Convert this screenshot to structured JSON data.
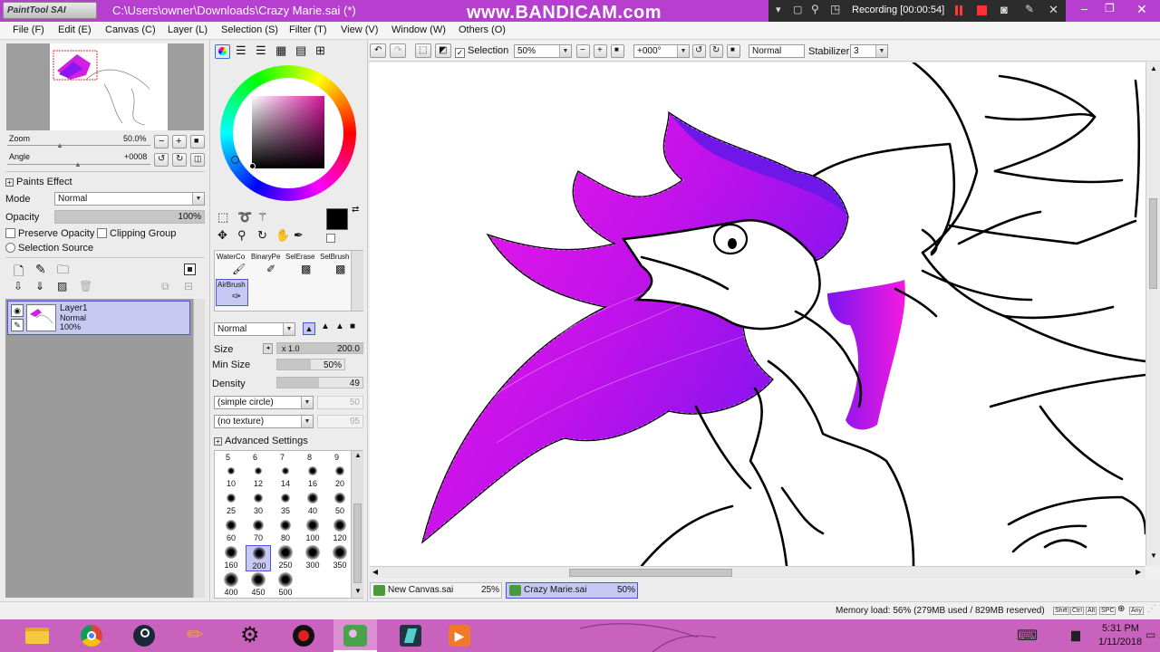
{
  "window": {
    "app_logo": "PaintTool SAI",
    "title": "C:\\Users\\owner\\Downloads\\Crazy Marie.sai (*)",
    "watermark": "www.BANDICAM.com"
  },
  "recorder": {
    "status": "Recording [00:00:54]"
  },
  "menu": [
    "File (F)",
    "Edit (E)",
    "Canvas (C)",
    "Layer (L)",
    "Selection (S)",
    "Filter (T)",
    "View (V)",
    "Window (W)",
    "Others (O)"
  ],
  "navigator": {
    "zoom_label": "Zoom",
    "zoom_value": "50.0%",
    "angle_label": "Angle",
    "angle_value": "+0008"
  },
  "layer_panel": {
    "header": "Paints Effect",
    "mode_label": "Mode",
    "mode_value": "Normal",
    "opacity_label": "Opacity",
    "opacity_value": "100%",
    "preserve_opacity": "Preserve Opacity",
    "clipping_group": "Clipping Group",
    "selection_source": "Selection Source",
    "layers": [
      {
        "name": "Layer1",
        "mode": "Normal",
        "opacity": "100%"
      }
    ]
  },
  "toolbar": {
    "selection_label": "Selection",
    "zoom_value": "50%",
    "angle_value": "+000°",
    "blend_mode": "Normal",
    "stabilizer_label": "Stabilizer",
    "stabilizer_value": "3"
  },
  "tools": {
    "brushes": [
      {
        "label": "WaterCo",
        "icon": "water-color-icon"
      },
      {
        "label": "BinaryPe",
        "icon": "binary-pen-icon"
      },
      {
        "label": "SelErase",
        "icon": "selection-eraser-icon"
      },
      {
        "label": "SelBrush",
        "icon": "selection-brush-icon"
      },
      {
        "label": "AirBrush",
        "icon": "airbrush-icon"
      }
    ],
    "active_brush": "AirBrush",
    "brush_mode": "Normal",
    "size_label": "Size",
    "size_mult": "x 1.0",
    "size_value": "200.0",
    "minsize_label": "Min Size",
    "minsize_value": "50%",
    "density_label": "Density",
    "density_value": "49",
    "shape_value": "(simple circle)",
    "shape_amount": "50",
    "texture_value": "(no texture)",
    "texture_amount": "95",
    "advanced": "Advanced Settings",
    "size_header": [
      "5",
      "6",
      "7",
      "8",
      "9"
    ],
    "size_presets": [
      "10",
      "12",
      "14",
      "16",
      "20",
      "25",
      "30",
      "35",
      "40",
      "50",
      "60",
      "70",
      "80",
      "100",
      "120",
      "160",
      "200",
      "250",
      "300",
      "350",
      "400",
      "450",
      "500"
    ],
    "selected_preset": "200",
    "primary_color": "#000000"
  },
  "tabs": [
    {
      "name": "New Canvas.sai",
      "zoom": "25%"
    },
    {
      "name": "Crazy Marie.sai",
      "zoom": "50%"
    }
  ],
  "status": {
    "memory": "Memory load: 56% (279MB used / 829MB reserved)",
    "keys": [
      "Shift",
      "Ctrl",
      "Alt",
      "SPC",
      "Any"
    ]
  },
  "taskbar": {
    "apps": [
      "file-explorer-icon",
      "chrome-icon",
      "steam-icon",
      "pencil-app-icon",
      "settings-app-icon",
      "bandicam-icon",
      "paint-tool-sai-icon",
      "media-app-icon",
      "play-app-icon"
    ],
    "time": "5:31 PM",
    "date": "1/11/2018"
  },
  "colors": {
    "accent_purple": "#8a16f0",
    "accent_magenta": "#f418e8",
    "taskbar": "#c862bd"
  }
}
